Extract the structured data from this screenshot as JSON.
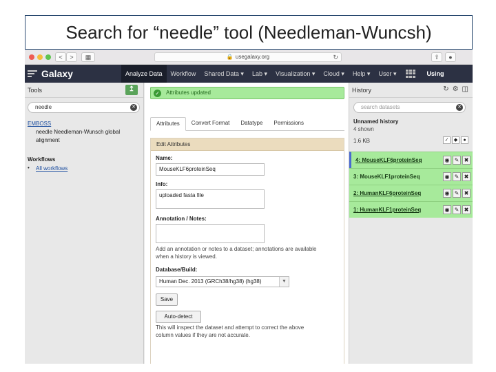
{
  "slide": {
    "title": "Search for “needle” tool (Needleman-Wuncsh)"
  },
  "browser": {
    "back_label": "<",
    "forward_label": ">",
    "url": "usegalaxy.org",
    "reload_icon": "reload-icon"
  },
  "masthead": {
    "brand": "Galaxy",
    "nav": [
      "Analyze Data",
      "Workflow",
      "Shared Data ▾",
      "Lab ▾",
      "Visualization ▾",
      "Cloud ▾",
      "Help ▾",
      "User ▾"
    ],
    "overflow_label": "Using"
  },
  "tools": {
    "title": "Tools",
    "search_value": "needle",
    "section": "EMBOSS",
    "result_line1": "needle Needleman-Wunsch global",
    "result_line2": "alignment",
    "workflows_title": "Workflows",
    "all_workflows": "All workflows"
  },
  "center": {
    "alert": "Attributes updated",
    "tabs": [
      "Attributes",
      "Convert Format",
      "Datatype",
      "Permissions"
    ],
    "edit_title": "Edit Attributes",
    "name_label": "Name:",
    "name_value": "MouseKLF6proteinSeq",
    "info_label": "Info:",
    "info_value": "uploaded fasta file",
    "annotation_label": "Annotation / Notes:",
    "annotation_help_1": "Add an annotation or notes to a dataset; annotations are available",
    "annotation_help_2": "when a history is viewed.",
    "db_label": "Database/Build:",
    "db_value": "Human Dec. 2013 (GRCh38/hg38) (hg38)",
    "save_label": "Save",
    "autodetect_label": "Auto-detect",
    "autodetect_help_1": "This will inspect the dataset and attempt to correct the above",
    "autodetect_help_2": "column values if they are not accurate."
  },
  "history": {
    "title": "History",
    "search_placeholder": "search datasets",
    "name": "Unnamed history",
    "shown": "4 shown",
    "size": "1.6 KB",
    "datasets": [
      "4: MouseKLF6proteinSeq",
      "3: MouseKLF1proteinSeq",
      "2: HumanKLF6proteinSeq",
      "1: HumanKLF1proteinSeq"
    ]
  },
  "colors": {
    "success": "#a7ea9b",
    "masthead": "#2c3143",
    "panel_header": "#ebdcbe"
  }
}
